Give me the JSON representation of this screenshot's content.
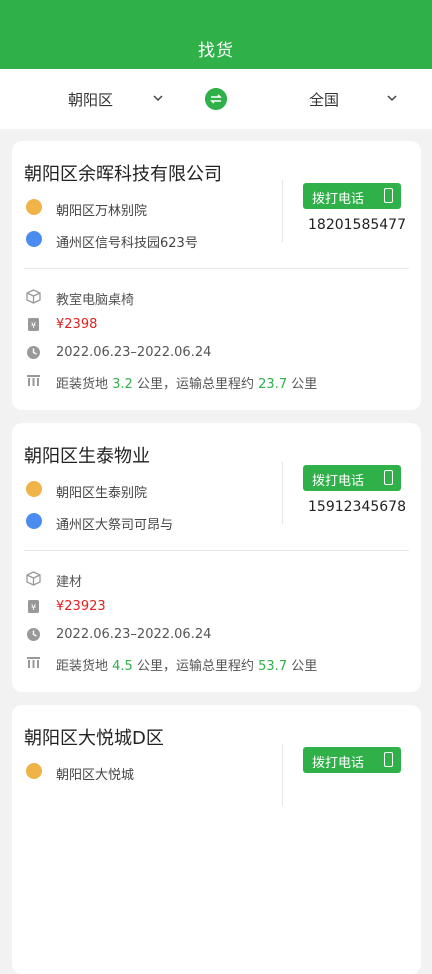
{
  "header": {
    "title": "找货"
  },
  "filter": {
    "from": "朝阳区",
    "to": "全国"
  },
  "cards": [
    {
      "company": "朝阳区余晖科技有限公司",
      "from_addr": "朝阳区万林别院",
      "to_addr": "通州区信号科技园623号",
      "call_label": "拨打电话",
      "phone": "18201585477",
      "goods": "教室电脑桌椅",
      "price": "¥2398",
      "date_range": "2022.06.23–2022.06.24",
      "dist_prefix": "距装货地",
      "dist_to_load": "3.2",
      "dist_mid": "公里，运输总里程约",
      "total_distance": "23.7",
      "dist_unit": "公里"
    },
    {
      "company": "朝阳区生泰物业",
      "from_addr": "朝阳区生泰别院",
      "to_addr": "通州区大祭司可昂与",
      "call_label": "拨打电话",
      "phone": "15912345678",
      "goods": "建材",
      "price": "¥23923",
      "date_range": "2022.06.23–2022.06.24",
      "dist_prefix": "距装货地",
      "dist_to_load": "4.5",
      "dist_mid": "公里，运输总里程约",
      "total_distance": "53.7",
      "dist_unit": "公里"
    },
    {
      "company": "朝阳区大悦城D区",
      "from_addr": "朝阳区大悦城",
      "call_label": "拨打电话"
    }
  ],
  "colors": {
    "brand": "#2fb049",
    "price": "#e02020",
    "from_icon": "#f0b347",
    "to_icon": "#4a8cf0"
  }
}
